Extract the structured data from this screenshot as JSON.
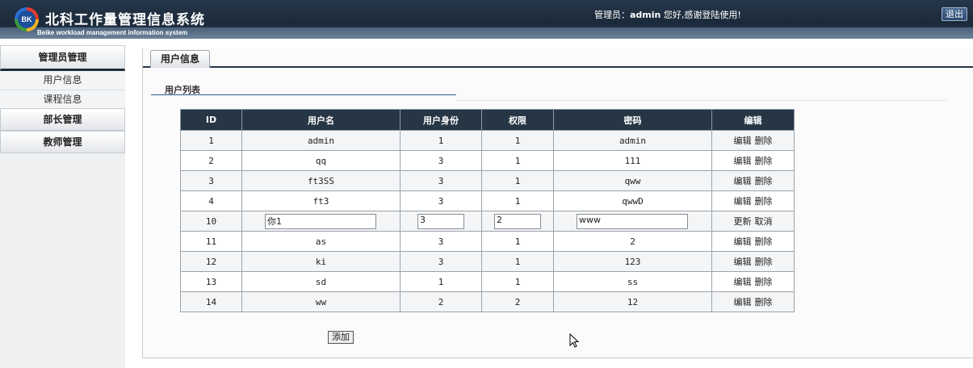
{
  "header": {
    "logo_text": "BK",
    "title": "北科工作量管理信息系统",
    "subtitle": "Beike workload management information system",
    "welcome_prefix": "管理员：",
    "welcome_user": "admin",
    "welcome_suffix": " 您好,感谢登陆使用!",
    "logout_label": "退出"
  },
  "sidebar": {
    "groups": [
      {
        "label": "管理员管理"
      },
      {
        "label": "部长管理"
      },
      {
        "label": "教师管理"
      }
    ],
    "items": [
      {
        "label": "用户信息"
      },
      {
        "label": "课程信息"
      }
    ]
  },
  "main": {
    "tab_label": "用户信息",
    "section_title": "用户列表",
    "add_button_label": "添加"
  },
  "table": {
    "columns": [
      "ID",
      "用户名",
      "用户身份",
      "权限",
      "密码",
      "编辑"
    ],
    "edit_label": "编辑",
    "delete_label": "删除",
    "update_label": "更新",
    "cancel_label": "取消",
    "rows": [
      {
        "id": "1",
        "username": "admin",
        "role": "1",
        "permission": "1",
        "password": "admin"
      },
      {
        "id": "2",
        "username": "qq",
        "role": "3",
        "permission": "1",
        "password": "111"
      },
      {
        "id": "3",
        "username": "ft3SS",
        "role": "3",
        "permission": "1",
        "password": "qww"
      },
      {
        "id": "4",
        "username": "ft3",
        "role": "3",
        "permission": "1",
        "password": "qwwD"
      },
      {
        "id": "10",
        "username": "你1",
        "role": "3",
        "permission": "2",
        "password": "www",
        "editing": true
      },
      {
        "id": "11",
        "username": "as",
        "role": "3",
        "permission": "1",
        "password": "2"
      },
      {
        "id": "12",
        "username": "ki",
        "role": "3",
        "permission": "1",
        "password": "123"
      },
      {
        "id": "13",
        "username": "sd",
        "role": "1",
        "permission": "1",
        "password": "ss"
      },
      {
        "id": "14",
        "username": "ww",
        "role": "2",
        "permission": "2",
        "password": "12"
      }
    ]
  }
}
